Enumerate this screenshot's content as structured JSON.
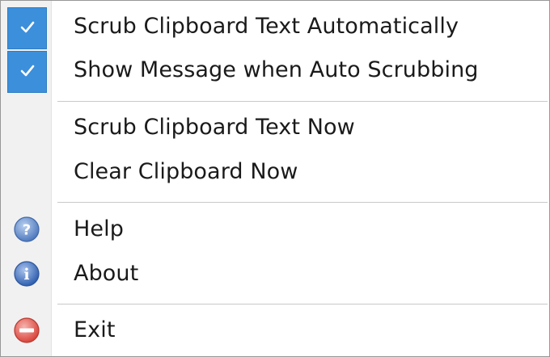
{
  "menu": {
    "items": [
      {
        "label": "Scrub Clipboard Text Automatically",
        "checked": true
      },
      {
        "label": "Show Message when Auto Scrubbing",
        "checked": true
      },
      {
        "label": "Scrub Clipboard Text Now"
      },
      {
        "label": "Clear Clipboard Now"
      },
      {
        "label": "Help",
        "icon": "help-icon"
      },
      {
        "label": "About",
        "icon": "info-icon"
      },
      {
        "label": "Exit",
        "icon": "exit-icon"
      }
    ]
  },
  "colors": {
    "check_highlight": "#3c8fdb",
    "help_icon": "#5b86c6",
    "info_icon": "#3d6fbf",
    "exit_icon": "#e05a52"
  }
}
